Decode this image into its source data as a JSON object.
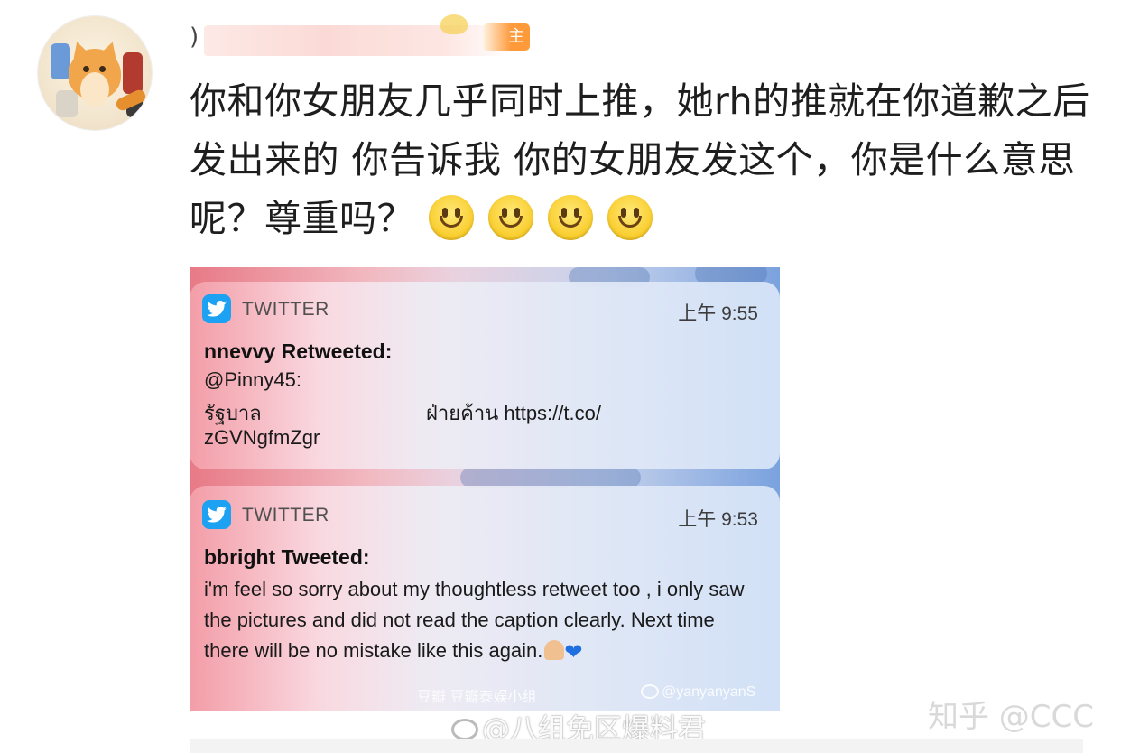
{
  "post": {
    "author_badge": "主",
    "comment_text": "你和你女朋友几乎同时上推，她rh的推就在你道歉之后发出来的 你告诉我 你的女朋友发这个，你是什么意思呢？尊重吗？",
    "emoji_count": 4
  },
  "screenshot": {
    "notifications": [
      {
        "app": "TWITTER",
        "time": "上午 9:55",
        "title": "nnevvy Retweeted:",
        "lines": [
          "@Pinny45:",
          "รัฐบาล",
          "ฝ่ายค้าน https://t.co/",
          "zGVNgfmZgr"
        ]
      },
      {
        "app": "TWITTER",
        "time": "上午 9:53",
        "title": "bbright Tweeted:",
        "body": "i'm feel so sorry about my thoughtless retweet too , i only saw the pictures and did not read the caption clearly. Next time there will be no mistake like this again."
      }
    ],
    "watermark_douban": "豆瓣  豆瓣泰娱小组",
    "watermark_weibo": "@yanyanyanS"
  },
  "watermarks": {
    "weibo_outer": "@八组免区爆料君",
    "zhihu": "知乎 @CCC"
  },
  "colors": {
    "twitter_blue": "#1da1f2",
    "badge_orange": "#ff9a3a"
  }
}
